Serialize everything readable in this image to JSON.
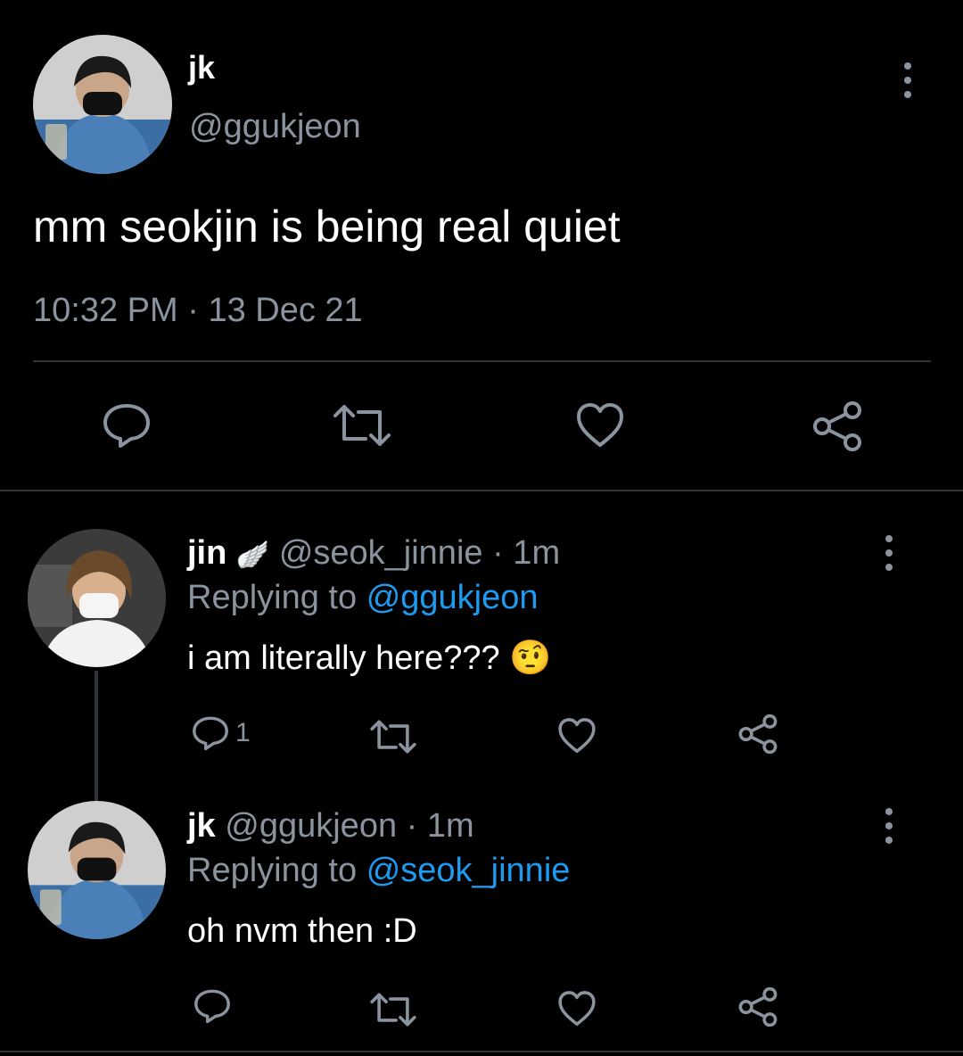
{
  "main_tweet": {
    "display_name": "jk",
    "handle": "@ggukjeon",
    "text": "mm seokjin is being real quiet",
    "timestamp": "10:32 PM",
    "separator": "·",
    "date": "13 Dec 21"
  },
  "replies": [
    {
      "display_name": "jin",
      "name_emoji": "🪽",
      "handle": "@seok_jinnie",
      "age": "· 1m",
      "replying_prefix": "Replying to",
      "replying_to": "@ggukjeon",
      "text": "i am literally here???",
      "emoji": "🤨",
      "reply_count": "1"
    },
    {
      "display_name": "jk",
      "handle": "@ggukjeon",
      "age": "· 1m",
      "replying_prefix": "Replying to",
      "replying_to": "@seok_jinnie",
      "text": "oh nvm then :D",
      "reply_count": ""
    }
  ],
  "colors": {
    "background": "#000000",
    "muted": "#8b949e",
    "link": "#1d9bf0",
    "divider": "#2f3336"
  },
  "icons": [
    "reply-icon",
    "retweet-icon",
    "like-icon",
    "share-icon",
    "more-options-icon"
  ]
}
